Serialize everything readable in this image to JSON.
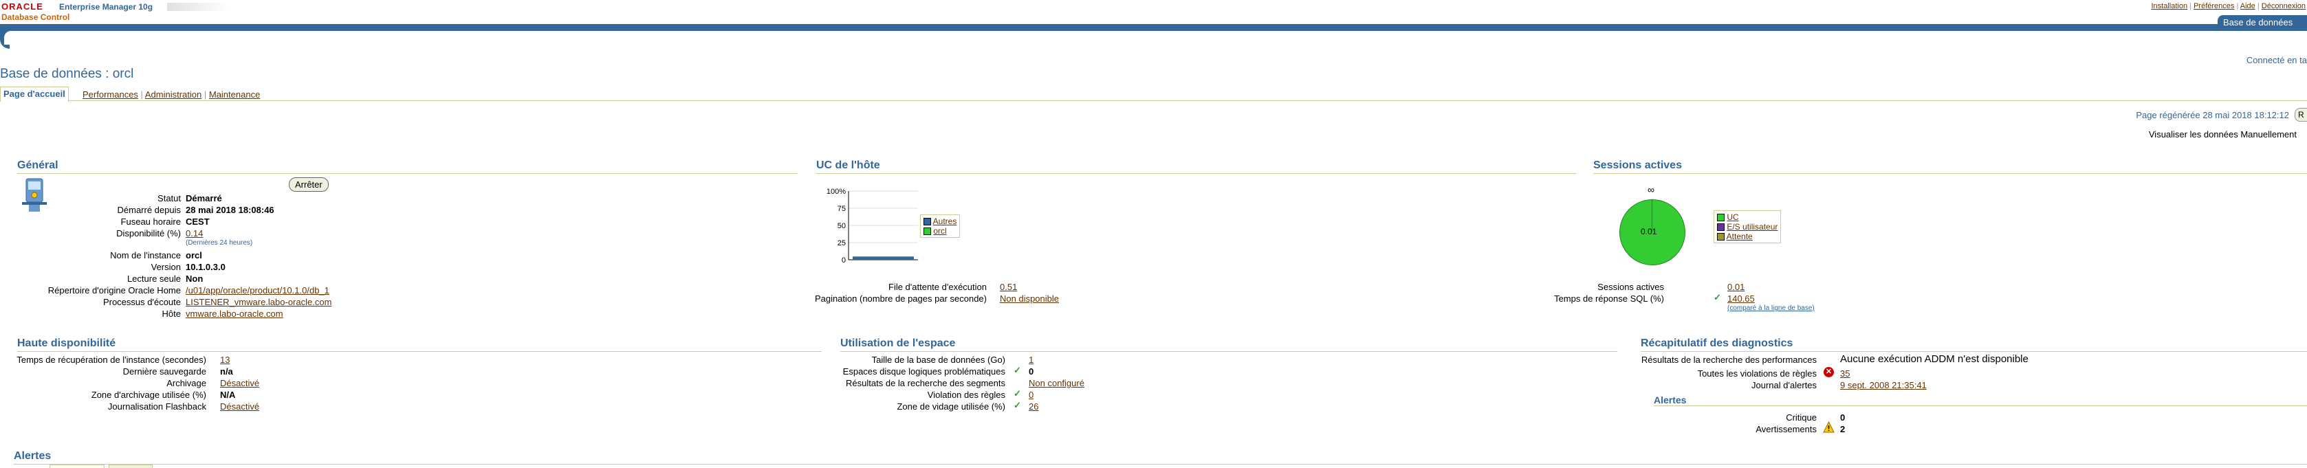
{
  "header": {
    "oracle_logo": "ORACLE",
    "product_name": "Enterprise Manager 10g",
    "subtitle": "Database Control",
    "links": [
      "Installation",
      "Préférences",
      "Aide",
      "Déconnexion"
    ],
    "tab_label": "Base de données",
    "connected_label": "Connecté en ta"
  },
  "page": {
    "title": "Base de données : orcl",
    "tabs": [
      "Page d'accueil",
      "Performances",
      "Administration",
      "Maintenance"
    ],
    "regenerated_label": "Page régénérée",
    "regenerated_value": "28 mai 2018 18:12:12",
    "refresh_btn": "R",
    "view_data_label": "Visualiser les données",
    "view_data_value": "Manuellement"
  },
  "general": {
    "title": "Général",
    "stop_button": "Arrêter",
    "rows": [
      {
        "label": "Statut",
        "value": "Démarré",
        "bold": true
      },
      {
        "label": "Démarré depuis",
        "value": "28 mai 2018 18:08:46",
        "bold": true
      },
      {
        "label": "Fuseau horaire",
        "value": "CEST",
        "bold": true
      },
      {
        "label": "Disponibilité (%)",
        "value": "0.14",
        "link": true
      },
      {
        "label": "Nom de l'instance",
        "value": "orcl",
        "bold": true
      },
      {
        "label": "Version",
        "value": "10.1.0.3.0",
        "bold": true
      },
      {
        "label": "Lecture seule",
        "value": "Non",
        "bold": true
      },
      {
        "label": "Répertoire d'origine Oracle Home",
        "value": "/u01/app/oracle/product/10.1.0/db_1",
        "link": true
      },
      {
        "label": "Processus d'écoute",
        "value": "LISTENER_vmware.labo-oracle.com",
        "link": true
      },
      {
        "label": "Hôte",
        "value": "vmware.labo-oracle.com",
        "link": true
      }
    ],
    "availability_note": "(Dernières 24 heures)"
  },
  "cpu": {
    "title": "UC de l'hôte",
    "y_ticks": [
      "100%",
      "75",
      "50",
      "25",
      "0"
    ],
    "legend": [
      "Autres",
      "orcl"
    ],
    "legend_colors": [
      "#336699",
      "#33cc33"
    ],
    "rows": [
      {
        "label": "File d'attente d'exécution",
        "value": "0.51"
      },
      {
        "label": "Pagination (nombre de pages par seconde)",
        "value": "Non disponible"
      }
    ]
  },
  "chart_data": {
    "type": "bar",
    "categories": [
      "Autres",
      "orcl"
    ],
    "values": [
      4,
      1
    ],
    "ylim": [
      0,
      100
    ]
  },
  "sessions": {
    "title": "Sessions actives",
    "pie_top_label": "∞",
    "pie_center": "0.01",
    "legend": [
      "UC",
      "E/S utilisateur",
      "Attente"
    ],
    "legend_colors": [
      "#33cc33",
      "#663399",
      "#999933"
    ],
    "rows": [
      {
        "label": "Sessions actives",
        "value": "0.01"
      },
      {
        "label": "Temps de réponse SQL (%)",
        "value": "140.65"
      }
    ],
    "sql_note": "(comparé à la ligne de base)"
  },
  "ha": {
    "title": "Haute disponibilité",
    "rows": [
      {
        "label": "Temps de récupération de l'instance (secondes)",
        "value": "13",
        "link": true
      },
      {
        "label": "Dernière sauvegarde",
        "value": "n/a",
        "bold": true
      },
      {
        "label": "Archivage",
        "value": "Désactivé",
        "link": true
      },
      {
        "label": "Zone d'archivage utilisée (%)",
        "value": "N/A",
        "bold": true
      },
      {
        "label": "Journalisation Flashback",
        "value": "Désactivé",
        "link": true
      }
    ]
  },
  "space": {
    "title": "Utilisation de l'espace",
    "rows": [
      {
        "label": "Taille de la base de données (Go)",
        "value": "1",
        "link": true,
        "check": false
      },
      {
        "label": "Espaces disque logiques problématiques",
        "value": "0",
        "bold": true,
        "check": true
      },
      {
        "label": "Résultats de la recherche des segments",
        "value": "Non configuré",
        "link": true,
        "check": false
      },
      {
        "label": "Violation des règles",
        "value": "0",
        "link": true,
        "check": true
      },
      {
        "label": "Zone de vidage utilisée (%)",
        "value": "26",
        "link": true,
        "check": true
      }
    ]
  },
  "diag": {
    "title": "Récapitulatif des diagnostics",
    "addm_label": "Résultats de la recherche des performances",
    "addm_value": "Aucune exécution ADDM n'est disponible",
    "violations_label": "Toutes les violations de règles",
    "violations_value": "35",
    "alert_log_label": "Journal d'alertes",
    "alert_log_value": "9 sept. 2008 21:35:41",
    "alerts_subtitle": "Alertes",
    "critical_label": "Critique",
    "critical_value": "0",
    "warnings_label": "Avertissements",
    "warnings_value": "2"
  },
  "alerts": {
    "title": "Alertes"
  }
}
